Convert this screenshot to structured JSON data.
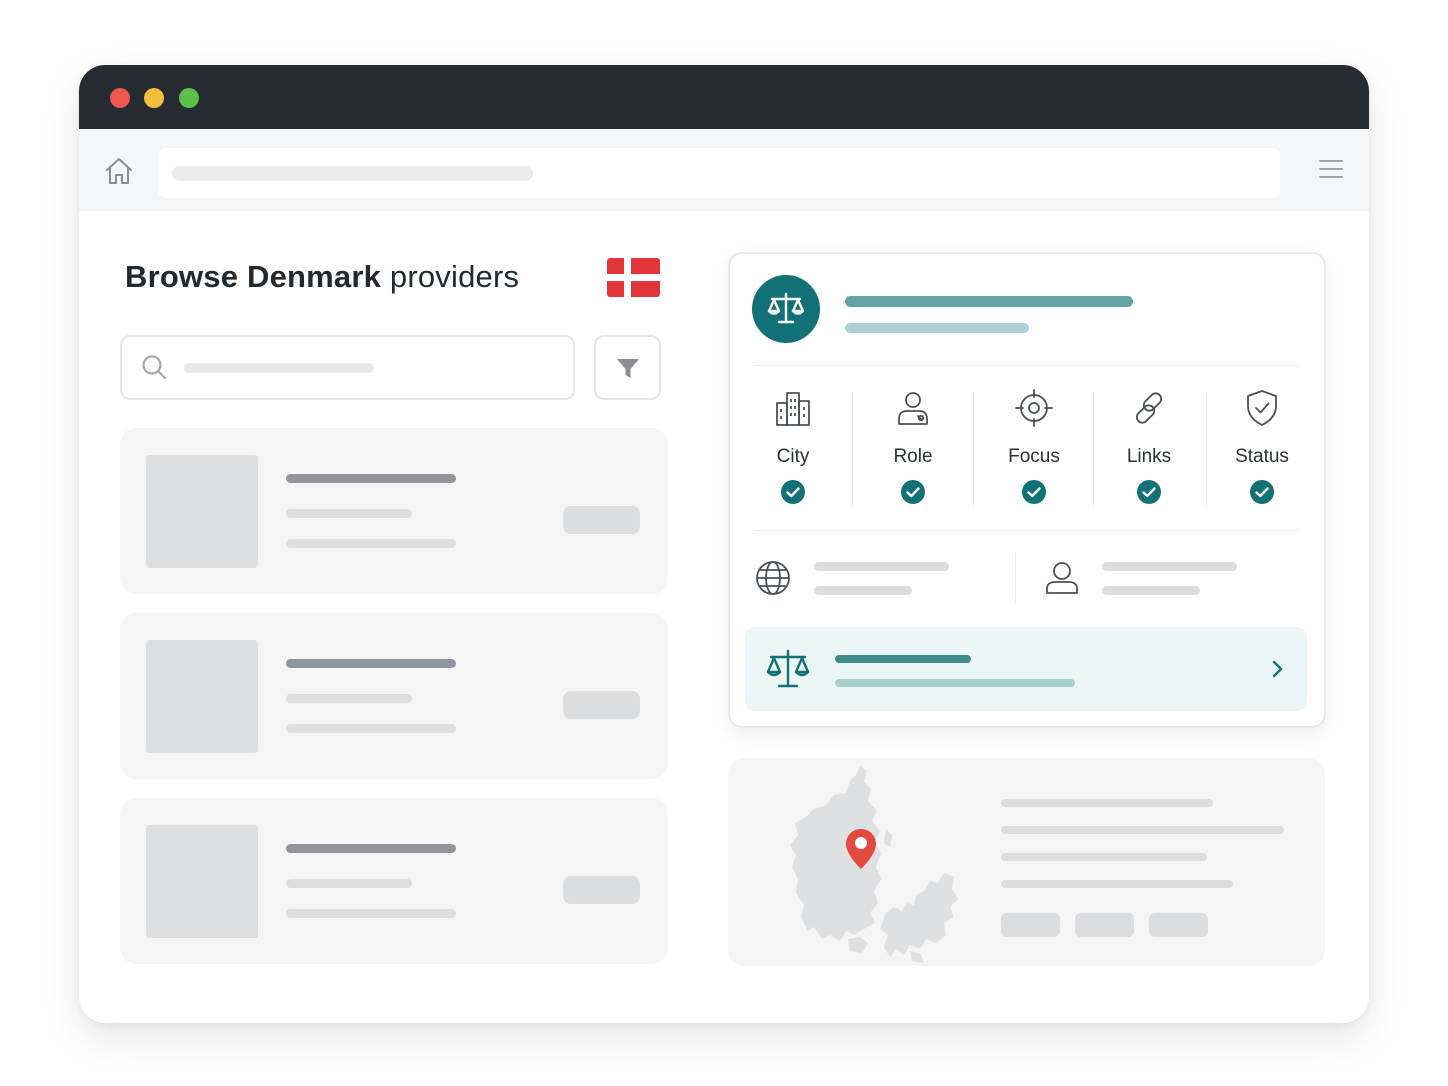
{
  "page": {
    "title_bold": "Browse Denmark",
    "title_rest": " providers"
  },
  "window_controls": {
    "close_color": "#ee5a52",
    "minimize_color": "#f4be3d",
    "maximize_color": "#5cc04a"
  },
  "icons": {
    "home": "home-icon",
    "menu": "hamburger-menu-icon",
    "search": "search-icon",
    "filter": "filter-funnel-icon",
    "flag": "denmark-flag-icon",
    "provider": "scales-of-justice-icon",
    "website": "globe-icon",
    "contact": "person-icon",
    "cta_chevron": "chevron-right-icon",
    "map_pin": "map-pin-icon"
  },
  "features": [
    {
      "label": "City",
      "icon": "city-buildings-icon",
      "verified": true
    },
    {
      "label": "Role",
      "icon": "person-role-icon",
      "verified": true
    },
    {
      "label": "Focus",
      "icon": "crosshair-target-icon",
      "verified": true
    },
    {
      "label": "Links",
      "icon": "chain-link-icon",
      "verified": true
    },
    {
      "label": "Status",
      "icon": "shield-check-icon",
      "verified": true
    }
  ],
  "colors": {
    "accent": "#127177",
    "flag_red": "#e2363b",
    "pin_red": "#e24a3f",
    "titlebar": "#262b31"
  }
}
